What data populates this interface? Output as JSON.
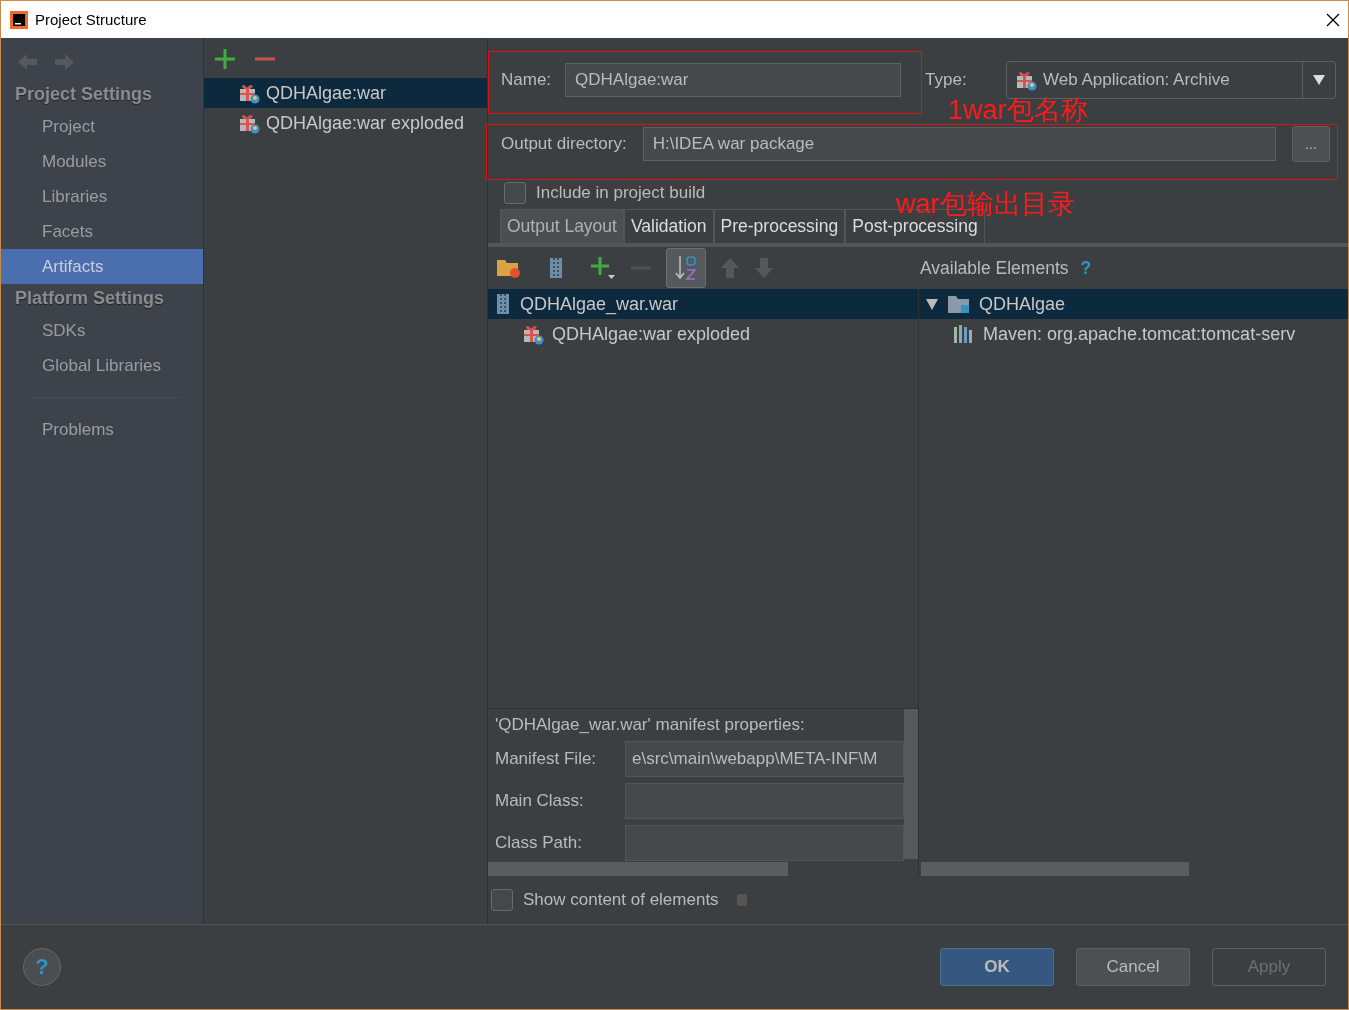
{
  "window": {
    "title": "Project Structure"
  },
  "sidebar": {
    "sections": [
      {
        "heading": "Project Settings",
        "items": [
          {
            "label": "Project",
            "selected": false
          },
          {
            "label": "Modules",
            "selected": false
          },
          {
            "label": "Libraries",
            "selected": false
          },
          {
            "label": "Facets",
            "selected": false
          },
          {
            "label": "Artifacts",
            "selected": true
          }
        ]
      },
      {
        "heading": "Platform Settings",
        "items": [
          {
            "label": "SDKs",
            "selected": false
          },
          {
            "label": "Global Libraries",
            "selected": false
          }
        ]
      }
    ],
    "footer_items": [
      {
        "label": "Problems",
        "selected": false
      }
    ]
  },
  "artifacts": [
    {
      "label": "QDHAlgae:war",
      "selected": true
    },
    {
      "label": "QDHAlgae:war exploded",
      "selected": false
    }
  ],
  "form": {
    "name_label": "Name:",
    "name_value": "QDHAlgae:war",
    "type_label": "Type:",
    "type_value": "Web Application: Archive",
    "output_label": "Output directory:",
    "output_value": "H:\\IDEA war package",
    "browse_button": "...",
    "include": {
      "label": "Include in project build",
      "checked": false
    }
  },
  "tabs": [
    {
      "label": "Output Layout",
      "selected": true
    },
    {
      "label": "Validation",
      "selected": false
    },
    {
      "label": "Pre-processing",
      "selected": false
    },
    {
      "label": "Post-processing",
      "selected": false
    }
  ],
  "layout_tree": [
    {
      "label": "QDHAlgae_war.war",
      "kind": "archive",
      "selected": true,
      "children": [
        {
          "label": "QDHAlgae:war exploded",
          "kind": "artifact",
          "selected": false
        }
      ]
    }
  ],
  "available_elements": {
    "title": "Available Elements",
    "help": "?",
    "tree": [
      {
        "label": "QDHAlgae",
        "kind": "module",
        "expanded": true,
        "selected": true,
        "children": [
          {
            "label": "Maven: org.apache.tomcat:tomcat-serv",
            "kind": "library",
            "selected": false
          }
        ]
      }
    ]
  },
  "manifest": {
    "title": "'QDHAlgae_war.war' manifest properties:",
    "fields": [
      {
        "label": "Manifest File:",
        "value": "e\\src\\main\\webapp\\META-INF\\M"
      },
      {
        "label": "Main Class:"
      },
      {
        "label": "Class Path:"
      }
    ]
  },
  "show_content": {
    "label": "Show content of elements",
    "checked": false
  },
  "help_button": "?",
  "buttons": [
    {
      "label": "OK",
      "kind": "primary",
      "disabled": false
    },
    {
      "label": "Cancel",
      "kind": "default",
      "disabled": false
    },
    {
      "label": "Apply",
      "kind": "default",
      "disabled": true
    }
  ],
  "annotations": [
    {
      "text": "1war包名称"
    },
    {
      "text": "war包输出目录"
    }
  ]
}
